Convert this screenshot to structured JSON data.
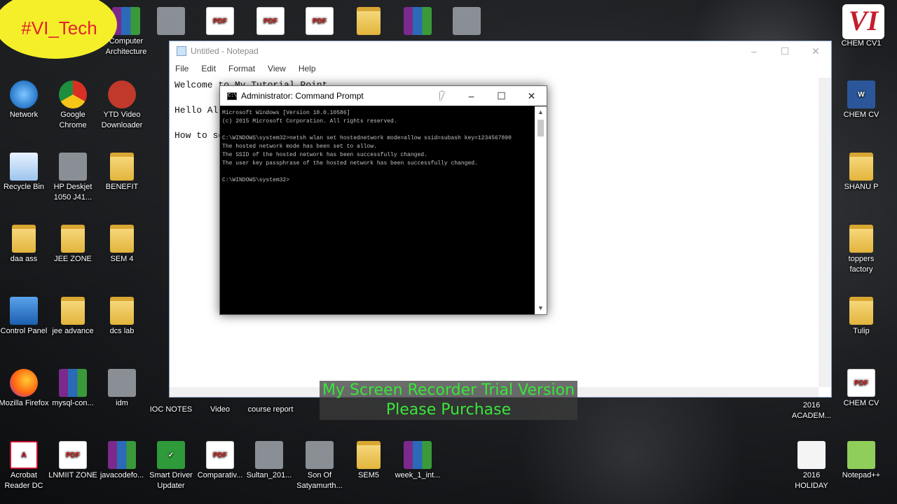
{
  "branding": {
    "badge": "#VI_Tech",
    "logo": "VI"
  },
  "desktop_icons": [
    {
      "label": "Network",
      "icon": "network-icon"
    },
    {
      "label": "Google Chrome",
      "icon": "chrome-icon"
    },
    {
      "label": "YTD Video Downloader",
      "icon": "ytd-icon"
    },
    {
      "label": "Recycle Bin",
      "icon": "recycle-bin-icon"
    },
    {
      "label": "HP Deskjet 1050 J41...",
      "icon": "printer-icon"
    },
    {
      "label": "BENEFIT",
      "icon": "folder-icon"
    },
    {
      "label": "daa ass",
      "icon": "folder-icon"
    },
    {
      "label": "JEE ZONE",
      "icon": "folder-icon"
    },
    {
      "label": "SEM 4",
      "icon": "folder-icon"
    },
    {
      "label": "Control Panel",
      "icon": "control-panel-icon"
    },
    {
      "label": "jee advance",
      "icon": "folder-icon"
    },
    {
      "label": "dcs lab",
      "icon": "folder-icon"
    },
    {
      "label": "Mozilla Firefox",
      "icon": "firefox-icon"
    },
    {
      "label": "mysql-con...",
      "icon": "archive-icon"
    },
    {
      "label": "idm",
      "icon": "app-icon"
    },
    {
      "label": "IOC NOTES",
      "icon": "folder-icon"
    },
    {
      "label": "Video",
      "icon": "folder-icon"
    },
    {
      "label": "course report",
      "icon": "folder-icon"
    },
    {
      "label": "Acrobat Reader DC",
      "icon": "acrobat-icon"
    },
    {
      "label": "LNMIIT ZONE",
      "icon": "pdf-icon"
    },
    {
      "label": "javacodefo...",
      "icon": "archive-icon"
    },
    {
      "label": "Smart Driver Updater",
      "icon": "driver-updater-icon"
    },
    {
      "label": "Comparativ...",
      "icon": "pdf-icon"
    },
    {
      "label": "Sultan_201...",
      "icon": "video-icon"
    },
    {
      "label": "Son Of Satyamurth...",
      "icon": "video-icon"
    },
    {
      "label": "SEM5",
      "icon": "folder-icon"
    },
    {
      "label": "week_1_int...",
      "icon": "archive-icon"
    },
    {
      "label": "CHEM CV1",
      "icon": "logo-icon"
    },
    {
      "label": "CHEM CV",
      "icon": "word-icon"
    },
    {
      "label": "SHANU P",
      "icon": "folder-icon"
    },
    {
      "label": "toppers factory",
      "icon": "folder-icon"
    },
    {
      "label": "Tulip",
      "icon": "folder-icon"
    },
    {
      "label": "CHEM CV",
      "icon": "pdf-icon"
    },
    {
      "label": "2016 ACADEM...",
      "icon": "document-icon"
    },
    {
      "label": "2016 HOLIDAY",
      "icon": "document-icon"
    },
    {
      "label": "Notepad++",
      "icon": "notepadpp-icon"
    },
    {
      "label": "Computer Architecture",
      "icon": "archive-icon"
    }
  ],
  "notepad": {
    "title": "Untitled - Notepad",
    "menu": [
      "File",
      "Edit",
      "Format",
      "View",
      "Help"
    ],
    "text": "Welcome to My Tutorial Point\n\nHello All\n\nHow to sc",
    "controls": [
      "–",
      "☐",
      "✕"
    ]
  },
  "cmd": {
    "title": "Administrator: Command Prompt",
    "controls": [
      "–",
      "☐",
      "✕"
    ],
    "output": "Microsoft Windows [Version 10.0.10586]\n(c) 2015 Microsoft Corporation. All rights reserved.\n\nC:\\WINDOWS\\system32>netsh wlan set hostednetwork mode=allow ssid=subash key=1234567890\nThe hosted network mode has been set to allow.\nThe SSID of the hosted network has been successfully changed.\nThe user key passphrase of the hosted network has been successfully changed.\n\nC:\\WINDOWS\\system32>"
  },
  "watermark": {
    "line1": "My Screen Recorder Trial Version",
    "line2": "Please Purchase"
  }
}
